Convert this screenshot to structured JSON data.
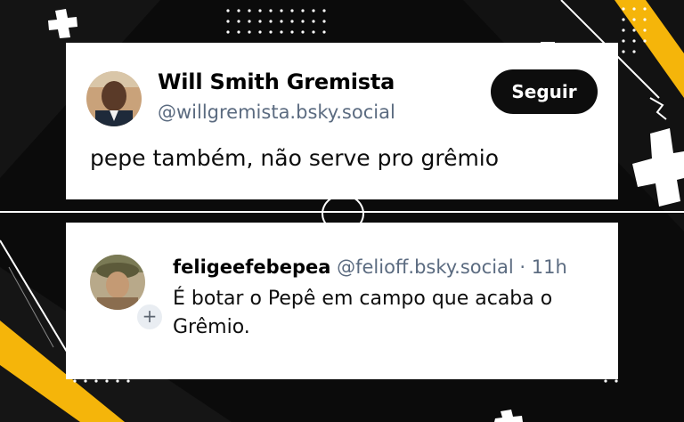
{
  "post": {
    "display_name": "Will Smith Gremista",
    "handle": "@willgremista.bsky.social",
    "follow_label": "Seguir",
    "text": "pepe também, não serve pro grêmio"
  },
  "reply": {
    "display_name": "feligeefebepea",
    "handle": "@felioff.bsky.social",
    "separator": "·",
    "time": "11h",
    "text": "É botar o Pepê em campo que acaba o Grêmio."
  },
  "colors": {
    "background": "#0b0b0b",
    "accent_yellow": "#f5b50a",
    "card": "#ffffff",
    "handle_gray": "#5b6b80",
    "button": "#0d0d0d"
  },
  "icons": {
    "follow_badge": "plus-icon",
    "decoration": "plus-shape"
  },
  "follow_badge_symbol": "+"
}
